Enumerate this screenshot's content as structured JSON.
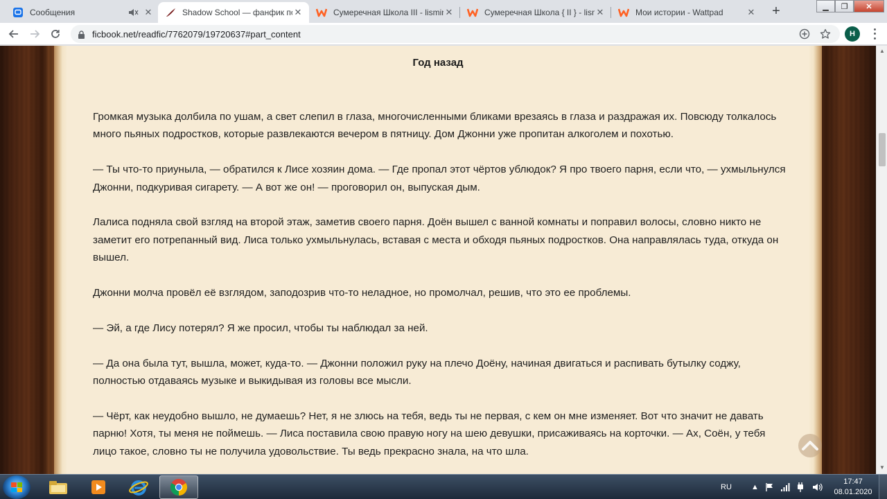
{
  "tabs": [
    {
      "title": "Сообщения",
      "icon": "messages-icon"
    },
    {
      "title": "Shadow School — фанфик по ф",
      "icon": "ficbook-feather-icon"
    },
    {
      "title": "Сумеречная Школа III - lisminc",
      "icon": "wattpad-icon"
    },
    {
      "title": "Сумеречная Школа { II } - lismi",
      "icon": "wattpad-icon"
    },
    {
      "title": "Мои истории - Wattpad",
      "icon": "wattpad-icon"
    }
  ],
  "toolbar": {
    "url": "ficbook.net/readfic/7762079/19720637#part_content",
    "avatar_letter": "H"
  },
  "content": {
    "heading": "Год назад",
    "paragraphs": [
      "Громкая музыка долбила по ушам, а свет слепил в глаза, многочисленными бликами врезаясь в глаза и раздражая их. Повсюду толкалось много пьяных подростков, которые развлекаются вечером в пятницу. Дом Джонни уже пропитан алкоголем и похотью.",
      "— Ты что-то приуныла, — обратился к Лисе хозяин дома. — Где пропал этот чёртов ублюдок? Я про твоего парня, если что, — ухмыльнулся Джонни, подкуривая сигарету. — А вот же он! — проговорил он, выпуская дым.",
      "Лалиса подняла свой взгляд на второй этаж, заметив своего парня. Доён вышел с ванной комнаты и поправил волосы, словно никто не заметит его потрепанный вид. Лиса только ухмыльнулась, вставая с места и обходя пьяных подростков. Она направлялась туда, откуда он вышел.",
      "Джонни молча провёл её взглядом, заподозрив что-то неладное, но промолчал, решив, что это ее проблемы.",
      "— Эй, а где Лису потерял? Я же просил, чтобы ты наблюдал за ней.",
      "— Да она была тут, вышла, может, куда-то. — Джонни положил руку на плечо Доёну, начиная двигаться и распивать бутылку соджу, полностью отдаваясь музыке и выкидывая из головы все мысли.",
      "— Чёрт, как неудобно вышло, не думаешь? Нет, я не злюсь на тебя, ведь ты не первая, с кем он мне изменяет. Вот что значит не давать парню! Хотя, ты меня не поймешь. — Лиса поставила свою правую ногу на шею девушки, присаживаясь на корточки. — Ах, Соён, у тебя лицо такое, словно ты не получила удовольствие. Ты ведь прекрасно знала, на что шла."
    ]
  },
  "taskbar": {
    "language": "RU",
    "time": "17:47",
    "date": "08.01.2020"
  },
  "colors": {
    "paper": "#f7ebd5",
    "wood": "#5f3017",
    "taskbar": "#1d2a3a",
    "avatar": "#0b5e4a"
  }
}
